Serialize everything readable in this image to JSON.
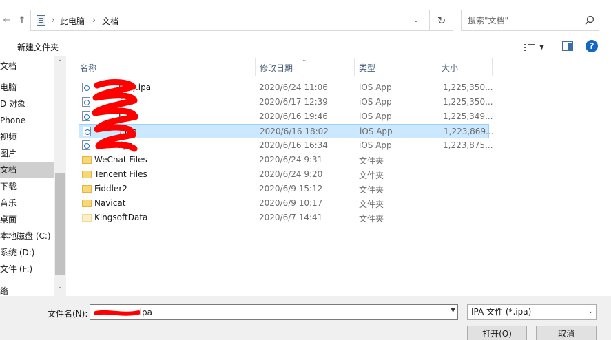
{
  "address_bar": {
    "breadcrumbs": [
      "此电脑",
      "文档"
    ],
    "search_placeholder": "搜索\"文档\""
  },
  "toolbar": {
    "new_folder_label": "新建文件夹",
    "help_label": "?"
  },
  "sidebar": {
    "items": [
      {
        "label": "文档",
        "selected": false
      },
      {
        "label": "电脑",
        "selected": false
      },
      {
        "label": "D 对象",
        "selected": false
      },
      {
        "label": "Phone",
        "selected": false
      },
      {
        "label": "视频",
        "selected": false
      },
      {
        "label": "图片",
        "selected": false
      },
      {
        "label": "文档",
        "selected": true
      },
      {
        "label": "下载",
        "selected": false
      },
      {
        "label": "音乐",
        "selected": false
      },
      {
        "label": "桌面",
        "selected": false
      },
      {
        "label": "本地磁盘 (C:)",
        "selected": false
      },
      {
        "label": "系统 (D:)",
        "selected": false
      },
      {
        "label": "文件 (F:)",
        "selected": false
      },
      {
        "label": "络",
        "selected": false
      }
    ]
  },
  "file_list": {
    "columns": {
      "name": "名称",
      "modified": "修改日期",
      "type": "类型",
      "size": "大小"
    },
    "rows": [
      {
        "name": "         ! (1).ipa",
        "modified": "2020/6/24 11:06",
        "type": "iOS App",
        "size": "1,225,350...",
        "kind": "ipa",
        "selected": false
      },
      {
        "name": "          ipa",
        "modified": "2020/6/17 12:39",
        "type": "iOS App",
        "size": "1,225,350...",
        "kind": "ipa",
        "selected": false
      },
      {
        "name": "         ! .ipa",
        "modified": "2020/6/16 19:46",
        "type": "iOS App",
        "size": "1,225,349...",
        "kind": "ipa",
        "selected": false
      },
      {
        "name": "         ).ipa",
        "modified": "2020/6/16 18:02",
        "type": "iOS App",
        "size": "1,223,869...",
        "kind": "ipa",
        "selected": true
      },
      {
        "name": "         .ipa",
        "modified": "2020/6/16 16:34",
        "type": "iOS App",
        "size": "1,223,875...",
        "kind": "ipa",
        "selected": false
      },
      {
        "name": "WeChat Files",
        "modified": "2020/6/24 9:31",
        "type": "文件夹",
        "size": "",
        "kind": "folder",
        "selected": false
      },
      {
        "name": "Tencent Files",
        "modified": "2020/6/24 9:20",
        "type": "文件夹",
        "size": "",
        "kind": "folder",
        "selected": false
      },
      {
        "name": "Fiddler2",
        "modified": "2020/6/9 15:12",
        "type": "文件夹",
        "size": "",
        "kind": "folder",
        "selected": false
      },
      {
        "name": "Navicat",
        "modified": "2020/6/9 10:17",
        "type": "文件夹",
        "size": "",
        "kind": "folder",
        "selected": false
      },
      {
        "name": "KingsoftData",
        "modified": "2020/6/7 14:41",
        "type": "文件夹",
        "size": "",
        "kind": "folder-faded",
        "selected": false
      }
    ]
  },
  "bottom": {
    "filename_label": "文件名(N):",
    "filename_value": "                  ipa",
    "filter_value": "IPA 文件 (*.ipa)",
    "open_label": "打开(O)",
    "cancel_label": "取消"
  },
  "colors": {
    "selection_bg": "#cce8ff",
    "selection_border": "#99d1ff",
    "redaction": "#ff0000",
    "help_blue": "#1467c4"
  }
}
